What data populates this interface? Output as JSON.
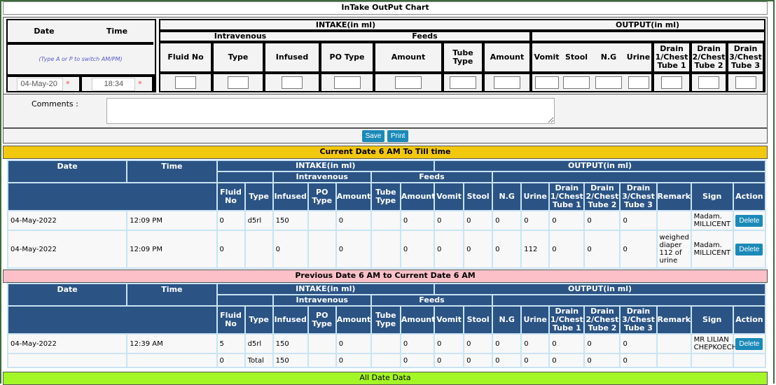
{
  "title": "InTake OutPut Chart",
  "form": {
    "date_label": "Date",
    "time_label": "Time",
    "hint": "(Type A or P to switch AM/PM)",
    "date_value": "04-May-20",
    "time_value": "18:34",
    "required_mark": "*",
    "intake_label": "INTAKE(in ml)",
    "output_label": "OUTPUT(in ml)",
    "intravenous_label": "Intravenous",
    "feeds_label": "Feeds",
    "columns": [
      "Fluid No",
      "Type",
      "Infused",
      "PO Type",
      "Amount",
      "Tube Type",
      "Amount",
      "Vomit",
      "Stool",
      "N.G",
      "Urine",
      "Drain 1/Chest Tube 1",
      "Drain 2/Chest Tube 2",
      "Drain 3/Chest Tube 3"
    ],
    "comments_label": "Comments :",
    "comments_value": "",
    "save_label": "Save",
    "print_label": "Print"
  },
  "table_headers": {
    "date": "Date",
    "time": "Time",
    "intake": "INTAKE(in ml)",
    "output": "OUTPUT(in ml)",
    "intravenous": "Intravenous",
    "feeds": "Feeds",
    "columns": [
      "Fluid No",
      "Type",
      "Infused",
      "PO Type",
      "Amount",
      "Tube Type",
      "Amount",
      "Vomit",
      "Stool",
      "N.G",
      "Urine",
      "Drain 1/Chest Tube 1",
      "Drain 2/Chest Tube 2",
      "Drain 3/Chest Tube 3",
      "Remark",
      "Sign",
      "Action"
    ]
  },
  "current": {
    "title": "Current Date 6 AM To Till time",
    "rows": [
      {
        "cells": [
          "04-May-2022",
          "12:09 PM",
          "0",
          "d5rl",
          "150",
          "",
          "0",
          "",
          "0",
          "0",
          "0",
          "0",
          "0",
          "0",
          "0",
          "0",
          "",
          "Madam. MILLICENT"
        ],
        "action": "Delete"
      },
      {
        "cells": [
          "04-May-2022",
          "12:09 PM",
          "0",
          "",
          "0",
          "",
          "0",
          "",
          "0",
          "0",
          "0",
          "0",
          "112",
          "0",
          "0",
          "0",
          "weighed diaper 112 of urine",
          "Madam. MILLICENT"
        ],
        "action": "Delete"
      }
    ]
  },
  "previous": {
    "title": "Previous Date 6 AM to Current Date 6 AM",
    "rows": [
      {
        "cells": [
          "04-May-2022",
          "12:39 AM",
          "5",
          "d5rl",
          "150",
          "",
          "0",
          "",
          "0",
          "0",
          "0",
          "0",
          "0",
          "0",
          "0",
          "0",
          "",
          "MR LILIAN CHEPKOECH"
        ],
        "action": "Delete"
      },
      {
        "cells": [
          "",
          "",
          "0",
          "Total",
          "150",
          "",
          "0",
          "",
          "0",
          "0",
          "0",
          "0",
          "0",
          "0",
          "0",
          "0",
          "",
          ""
        ],
        "action": ""
      }
    ]
  },
  "all_title": "All Date Data",
  "colors": {
    "header_bg": "#2b5384",
    "current_bar": "#f2c80f",
    "previous_bar": "#fbc0c8",
    "all_bar": "#a4f727",
    "button": "#1b8ab8"
  }
}
